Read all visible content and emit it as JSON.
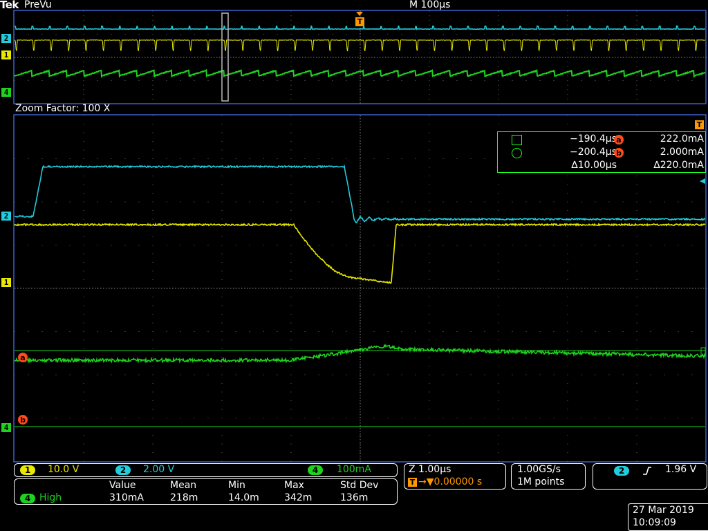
{
  "header": {
    "brand": "Tek",
    "mode": "PreVu",
    "horizontal_scale": "M 100µs",
    "trigger_marker": "T"
  },
  "zoom": {
    "label": "Zoom Factor: 100 X"
  },
  "channels": {
    "ch1": {
      "number": "1",
      "color": "#e8e800",
      "scale": "10.0 V"
    },
    "ch2": {
      "number": "2",
      "color": "#22ccdd",
      "scale": "2.00 V"
    },
    "ch4": {
      "number": "4",
      "color": "#1ed21e",
      "scale": "100mA"
    }
  },
  "ref_markers": {
    "a": "a",
    "b": "b"
  },
  "cursors": {
    "time_a": "−190.4µs",
    "time_b": "−200.4µs",
    "delta_time": "∆10.00µs",
    "value_a": "222.0mA",
    "value_b": "2.000mA",
    "delta_value": "∆220.0mA",
    "label_a": "a",
    "label_b": "b"
  },
  "zoom_panel": {
    "z_scale": "Z 1.00µs",
    "trigger_position": "→▼0.00000 s",
    "trigger_icon": "T"
  },
  "acquisition": {
    "sample_rate": "1.00GS/s",
    "record_length": "1M points"
  },
  "trigger": {
    "channel": "2",
    "slope_icon": "rising-edge-icon",
    "slope_glyph": "⨍",
    "level": "1.96 V"
  },
  "measurement": {
    "channel": "4",
    "name": "High",
    "headers": [
      "Value",
      "Mean",
      "Min",
      "Max",
      "Std Dev"
    ],
    "values": [
      "310mA",
      "218m",
      "14.0m",
      "342m",
      "136m"
    ]
  },
  "datetime": {
    "date": "27 Mar 2019",
    "time": "10:09:09"
  }
}
